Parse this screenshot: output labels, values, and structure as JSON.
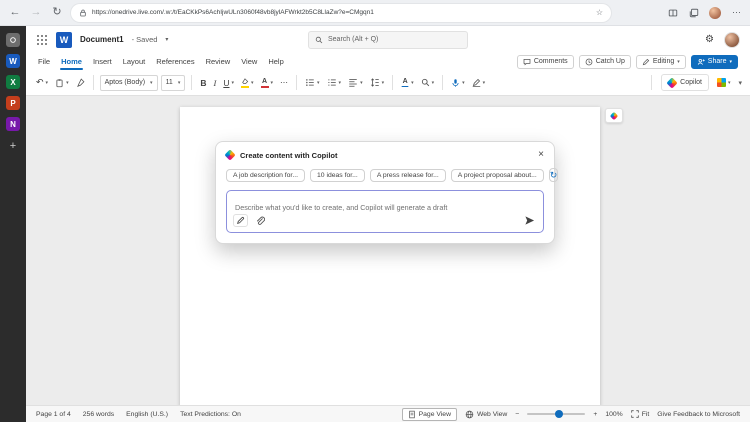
{
  "glyphs": {
    "back": "←",
    "forward": "→",
    "refresh": "↻",
    "star": "☆",
    "more": "⋯",
    "gear": "⚙",
    "chevron": "▾",
    "close": "×",
    "undo": "↶",
    "minus": "−",
    "plus": "+",
    "waffle_plus": "+"
  },
  "browser": {
    "url": "https://onedrive.live.com/.w:/t/EaCKkPs6AchIjwULn3060f48vb8jylAFWrkt2b5C8LlaZw?e=CMgqn1"
  },
  "sidebar": {
    "apps": [
      {
        "name": "workspace",
        "letter": ""
      },
      {
        "name": "word",
        "letter": "W"
      },
      {
        "name": "excel",
        "letter": "X"
      },
      {
        "name": "powerpoint",
        "letter": "P"
      },
      {
        "name": "onenote",
        "letter": "N"
      }
    ]
  },
  "header": {
    "doc_title": "Document1",
    "saved_status": "- Saved",
    "search_placeholder": "Search (Alt + Q)"
  },
  "menu": {
    "items": [
      "File",
      "Home",
      "Insert",
      "Layout",
      "References",
      "Review",
      "View",
      "Help"
    ]
  },
  "actions": {
    "comments": "Comments",
    "catch_up": "Catch Up",
    "editing": "Editing",
    "share": "Share"
  },
  "ribbon": {
    "font_name": "Aptos (Body)",
    "font_size": "11",
    "bold": "B",
    "italic": "I",
    "underline": "U",
    "font_color_letter": "A",
    "styles_letter": "A",
    "more": "⋯",
    "copilot_label": "Copilot"
  },
  "copilot_dialog": {
    "title": "Create content with Copilot",
    "chips": [
      "A job description for...",
      "10 ideas for...",
      "A press release for...",
      "A project proposal about..."
    ],
    "input_placeholder": "Describe what you'd like to create, and Copilot will generate a draft"
  },
  "status_bar": {
    "page": "Page 1 of 4",
    "words": "256 words",
    "language": "English (U.S.)",
    "predictions": "Text Predictions: On",
    "page_view": "Page View",
    "web_view": "Web View",
    "zoom_level": "100%",
    "fit": "Fit",
    "feedback": "Give Feedback to Microsoft"
  },
  "colors": {
    "accent": "#0f6cbd",
    "word_blue": "#185abd",
    "canvas_bg": "#ececec",
    "copilot_input_border": "#8c90dd",
    "font_color_bar": "#d13438",
    "highlight_bar": "#ffd400"
  }
}
